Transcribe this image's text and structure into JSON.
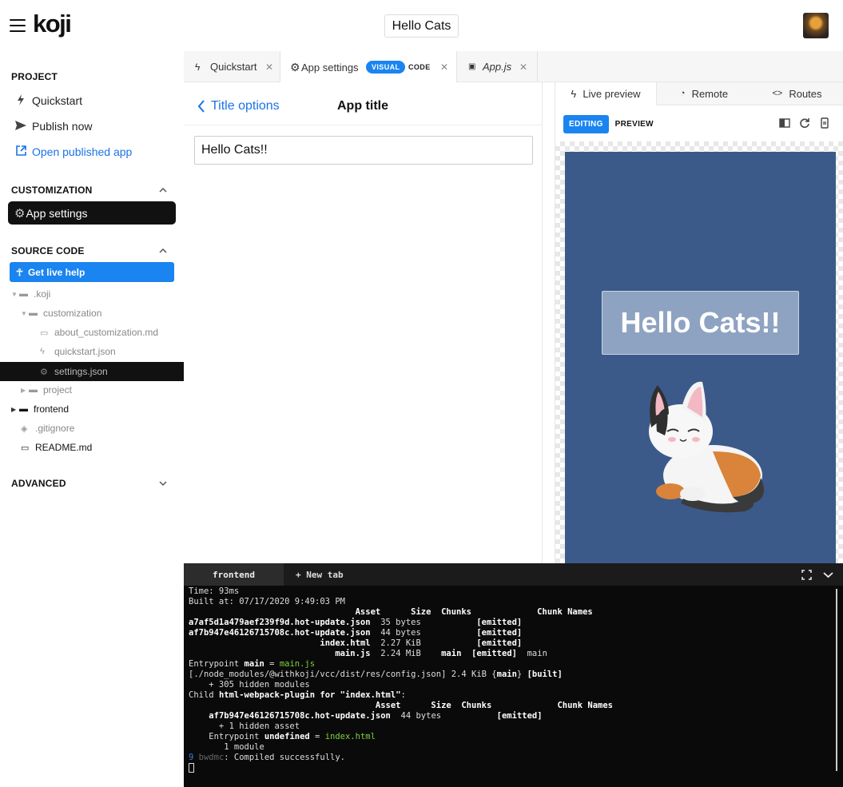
{
  "topbar": {
    "logo": "koji",
    "app_title": "Hello Cats"
  },
  "sidebar": {
    "project": {
      "title": "PROJECT",
      "items": [
        {
          "label": "Quickstart",
          "icon": "bolt-icon"
        },
        {
          "label": "Publish now",
          "icon": "send-icon"
        },
        {
          "label": "Open published app",
          "icon": "external-link-icon"
        }
      ]
    },
    "customization": {
      "title": "CUSTOMIZATION",
      "app_settings": "App settings"
    },
    "source_code": {
      "title": "SOURCE CODE",
      "live_help": "Get live help",
      "tree": [
        ".koji",
        "customization",
        "about_customization.md",
        "quickstart.json",
        "settings.json",
        "project",
        "frontend",
        ".gitignore",
        "README.md"
      ]
    },
    "advanced": {
      "title": "ADVANCED"
    }
  },
  "tabs": {
    "quickstart": "Quickstart",
    "app_settings": "App settings",
    "visual": "VISUAL",
    "code": "CODE",
    "appjs": "App.js"
  },
  "editor": {
    "back_label": "Title options",
    "title": "App title",
    "input_value": "Hello Cats!!"
  },
  "preview": {
    "tabs": [
      "Live preview",
      "Remote",
      "Routes"
    ],
    "mode_editing": "EDITING",
    "mode_preview": "PREVIEW",
    "app_heading": "Hello Cats!!",
    "colors": {
      "canvas": "#3b5a8a",
      "accent": "#1a84f0"
    }
  },
  "terminal": {
    "tab_frontend": "frontend",
    "tab_new": "+ New tab",
    "time": "Time: 93ms",
    "built_at": "Built at: 07/17/2020 9:49:03 PM",
    "header1": "                                 Asset      Size  Chunks             Chunk Names",
    "row1_name": "a7af5d1a479aef239f9d.hot-update.json",
    "row1_rest": "  35 bytes",
    "row1_tag": "[emitted]",
    "row2_name": "af7b947e46126715708c.hot-update.json",
    "row2_rest": "  44 bytes",
    "row2_tag": "[emitted]",
    "row3_pad": "                          ",
    "row3_name": "index.html",
    "row3_rest": "  2.27 KiB",
    "row3_tag": "[emitted]",
    "row4_pad": "                             ",
    "row4_name": "main.js",
    "row4_rest": "  2.24 MiB",
    "row4_chunk": "main",
    "row4_tag": "[emitted]",
    "row4_names": "  main",
    "entry1_a": "Entrypoint ",
    "entry1_b": "main",
    "entry1_c": " = ",
    "entry1_d": "main.js",
    "config_a": "[./node_modules/@withkoji/vcc/dist/res/config.json] 2.4 KiB {",
    "config_b": "main",
    "config_c": "} ",
    "config_d": "[built]",
    "hidden_modules": "    + 305 hidden modules",
    "child_a": "Child ",
    "child_b": "html-webpack-plugin",
    "child_c": " for ",
    "child_d": "\"index.html\"",
    "child_e": ":",
    "header2": "                                     Asset      Size  Chunks             Chunk Names",
    "row5_name": "af7b947e46126715708c.hot-update.json",
    "row5_rest": "  44 bytes",
    "row5_tag": "[emitted]",
    "hidden_asset": "      + 1 hidden asset",
    "entry2_a": "    Entrypoint ",
    "entry2_b": "undefined",
    "entry2_c": " = ",
    "entry2_d": "index.html",
    "module": "       1 module",
    "prompt_num": "9",
    "prompt_host": "bwdmc",
    "compiled": ": Compiled successfully."
  }
}
